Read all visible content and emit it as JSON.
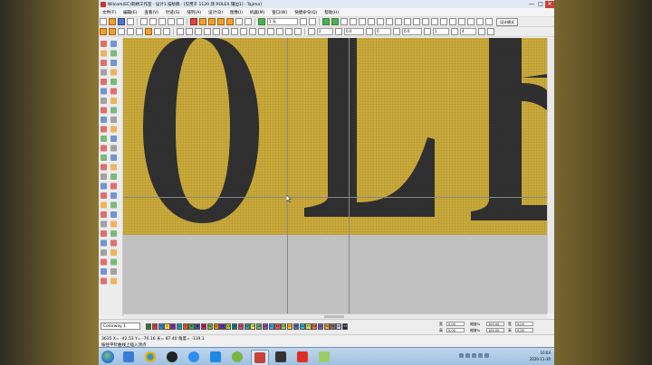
{
  "window": {
    "title": "Wilcom(EC)刺绣工作室 · 设计1 描绘稿 · [仅用于 1120 测 ROLEX 镶边1] · Tajima]",
    "minimize": "—",
    "maximize": "□",
    "close": "✕"
  },
  "menubar": {
    "items": [
      "文件(F)",
      "编辑(E)",
      "查看(V)",
      "针迹(S)",
      "排列(A)",
      "设计(D)",
      "图像(I)",
      "机器(M)",
      "窗口(W)",
      "快捷命令(Q)",
      "帮助(H)"
    ]
  },
  "toolbar2": {
    "fabric_field": "1 无",
    "design_mode_button": "设计模式"
  },
  "toolbar3": {
    "fields": [
      "2",
      "0.0",
      "0",
      "0.0",
      "1",
      "4"
    ]
  },
  "bottom": {
    "colorway_select": "Colorway 1",
    "swatches": [
      {
        "label": "1",
        "color": "#2e7d32"
      },
      {
        "label": "2",
        "color": "#e53935"
      },
      {
        "label": "3",
        "color": "#1e88e5"
      },
      {
        "label": "4",
        "color": "#fdd835"
      },
      {
        "label": "5",
        "color": "#8e24aa"
      },
      {
        "label": "6",
        "color": "#00acc1"
      },
      {
        "label": "7",
        "color": "#f4511e"
      },
      {
        "label": "8",
        "color": "#43a047"
      },
      {
        "label": "9",
        "color": "#3949ab"
      },
      {
        "label": "10",
        "color": "#d81b60"
      },
      {
        "label": "11",
        "color": "#7cb342"
      },
      {
        "label": "12",
        "color": "#fb8c00"
      },
      {
        "label": "13",
        "color": "#5e35b1"
      },
      {
        "label": "14",
        "color": "#c0ca33"
      },
      {
        "label": "15",
        "color": "#00897b"
      },
      {
        "label": "16",
        "color": "#ec407a"
      },
      {
        "label": "17",
        "color": "#26a69a"
      },
      {
        "label": "18",
        "color": "#ffee58"
      },
      {
        "label": "19",
        "color": "#66bb6a"
      },
      {
        "label": "20",
        "color": "#ab47bc"
      },
      {
        "label": "21",
        "color": "#29b6f6"
      },
      {
        "label": "22",
        "color": "#ef5350"
      },
      {
        "label": "23",
        "color": "#9ccc65"
      },
      {
        "label": "24",
        "color": "#ffca28"
      },
      {
        "label": "25",
        "color": "#5c6bc0"
      },
      {
        "label": "26",
        "color": "#26c6da"
      },
      {
        "label": "27",
        "color": "#d4e157"
      },
      {
        "label": "28",
        "color": "#ff7043"
      },
      {
        "label": "29",
        "color": "#7e57c2"
      },
      {
        "label": "30",
        "color": "#ffa726"
      },
      {
        "label": "31",
        "color": "#8d6e63"
      },
      {
        "label": "32",
        "color": "#d1c4e9"
      },
      {
        "label": "33",
        "color": "#212121"
      }
    ],
    "fields": {
      "w_label": "宽",
      "w_value": "0.00",
      "h_label": "高",
      "h_value": "0.00",
      "sx_label": "缩放%",
      "sx_value": "100.00",
      "sy_label": "缩放%",
      "sy_value": "100.00"
    }
  },
  "status": {
    "line1": "3635     X= -42.53  Y= -76.16  长= 87.40  角度= -119.1",
    "line2": "按住平针曲线上插入顶点"
  },
  "taskbar": {
    "time": "10:04",
    "date": "2020-11-30"
  }
}
